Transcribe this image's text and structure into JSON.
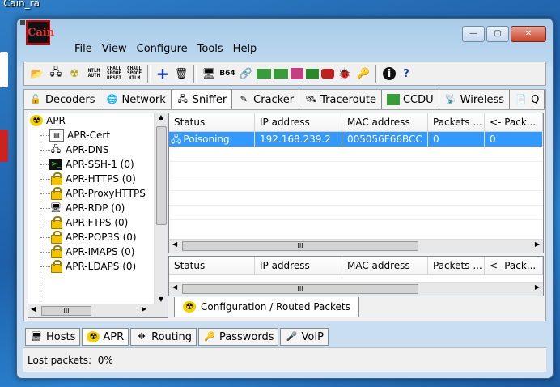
{
  "desktop": {
    "label": "Cain_ra"
  },
  "window": {
    "app_icon_text": "Cain",
    "menu": [
      "File",
      "View",
      "Configure",
      "Tools",
      "Help"
    ],
    "toolbar_small_labels": [
      [
        "NTLM",
        "AUTH"
      ],
      [
        "CHALL",
        "SPOOF",
        "RESET"
      ],
      [
        "CHALL",
        "SPOOF",
        "NTLM"
      ]
    ],
    "toolbar_b64_label": "B64"
  },
  "tabs": [
    {
      "label": "Decoders",
      "icon": "decoders-icon"
    },
    {
      "label": "Network",
      "icon": "network-icon"
    },
    {
      "label": "Sniffer",
      "icon": "sniffer-icon",
      "active": true
    },
    {
      "label": "Cracker",
      "icon": "cracker-icon"
    },
    {
      "label": "Traceroute",
      "icon": "traceroute-icon"
    },
    {
      "label": "CCDU",
      "icon": "ccdu-icon"
    },
    {
      "label": "Wireless",
      "icon": "wireless-icon"
    },
    {
      "label": "Q",
      "icon": "query-icon"
    }
  ],
  "tree": {
    "root": "APR",
    "items": [
      "APR-Cert",
      "APR-DNS",
      "APR-SSH-1 (0)",
      "APR-HTTPS (0)",
      "APR-ProxyHTTPS",
      "APR-RDP (0)",
      "APR-FTPS (0)",
      "APR-POP3S (0)",
      "APR-IMAPS (0)",
      "APR-LDAPS (0)"
    ]
  },
  "top_grid": {
    "columns": [
      "Status",
      "IP address",
      "MAC address",
      "Packets ...",
      "<- Pack..."
    ],
    "rows": [
      [
        "Poisoning",
        "192.168.239.2",
        "005056F66BCC",
        "0",
        "0"
      ]
    ]
  },
  "bottom_grid": {
    "columns": [
      "Status",
      "IP address",
      "MAC address",
      "Packets ...",
      "<- Pack..."
    ]
  },
  "scroll_glyph": "III",
  "inner_tab": "Configuration / Routed Packets",
  "bottom_tabs": [
    {
      "label": "Hosts",
      "icon": "hosts-icon"
    },
    {
      "label": "APR",
      "icon": "apr-icon",
      "active": true
    },
    {
      "label": "Routing",
      "icon": "routing-icon"
    },
    {
      "label": "Passwords",
      "icon": "passwords-icon"
    },
    {
      "label": "VoIP",
      "icon": "voip-icon"
    }
  ],
  "status": "Lost packets:  0%"
}
